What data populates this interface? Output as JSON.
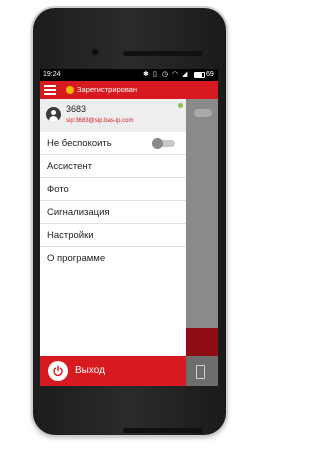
{
  "statusbar": {
    "time": "19:24",
    "battery": "69"
  },
  "header": {
    "status_text": "Зарегистрирован",
    "menu_icon": "hamburger-menu-icon"
  },
  "account": {
    "number": "3683",
    "sip_address": "sip:3683@sip.bas-ip.com",
    "presence_color": "#8bc34a"
  },
  "menu": {
    "dnd_label": "Не беспокоить",
    "dnd_enabled": false,
    "items": [
      {
        "label": "Ассистент"
      },
      {
        "label": "Фото"
      },
      {
        "label": "Сигнализация"
      },
      {
        "label": "Настройки"
      },
      {
        "label": "О программе"
      }
    ]
  },
  "logout": {
    "label": "Выход",
    "icon": "power-icon"
  },
  "colors": {
    "accent": "#d71920",
    "status_dot": "#f2b600"
  }
}
